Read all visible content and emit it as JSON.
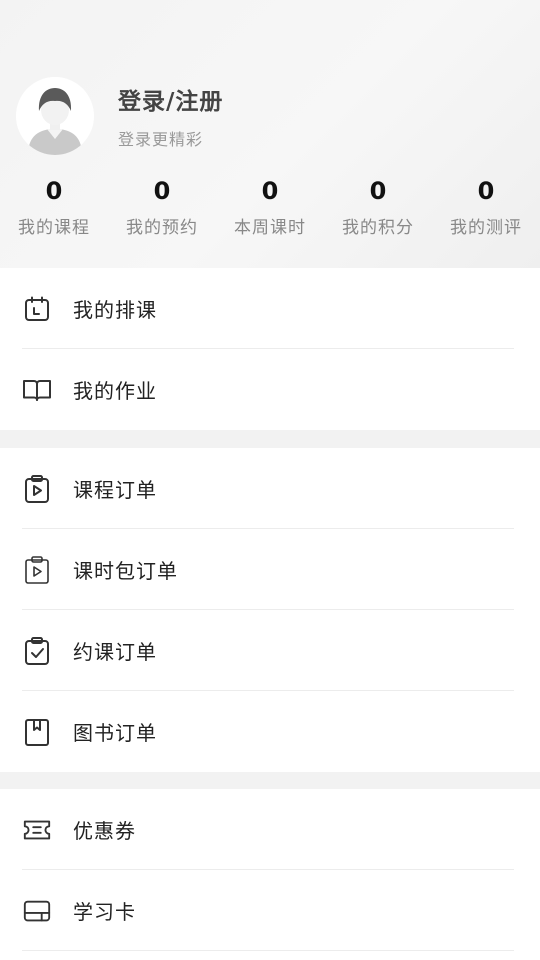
{
  "profile": {
    "login_title": "登录/注册",
    "login_subtitle": "登录更精彩"
  },
  "stats": [
    {
      "value": "0",
      "label": "我的课程"
    },
    {
      "value": "0",
      "label": "我的预约"
    },
    {
      "value": "0",
      "label": "本周课时"
    },
    {
      "value": "0",
      "label": "我的积分"
    },
    {
      "value": "0",
      "label": "我的测评"
    }
  ],
  "sections": [
    {
      "items": [
        {
          "label": "我的排课",
          "icon": "calendar-icon"
        },
        {
          "label": "我的作业",
          "icon": "book-open-icon"
        }
      ]
    },
    {
      "items": [
        {
          "label": "课程订单",
          "icon": "clipboard-play-icon"
        },
        {
          "label": "课时包订单",
          "icon": "clipboard-play-icon"
        },
        {
          "label": "约课订单",
          "icon": "clipboard-check-icon"
        },
        {
          "label": "图书订单",
          "icon": "bookmark-book-icon"
        }
      ]
    },
    {
      "items": [
        {
          "label": "优惠券",
          "icon": "ticket-icon"
        },
        {
          "label": "学习卡",
          "icon": "card-icon"
        }
      ]
    }
  ]
}
